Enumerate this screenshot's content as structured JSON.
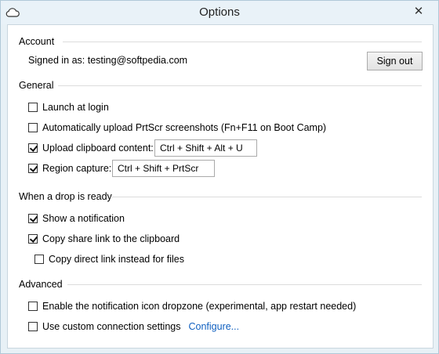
{
  "window": {
    "title": "Options",
    "close_glyph": "✕"
  },
  "account": {
    "heading": "Account",
    "signed_in_label": "Signed in as: testing@softpedia.com",
    "sign_out_label": "Sign out"
  },
  "general": {
    "heading": "General",
    "launch_at_login": {
      "label": "Launch at login",
      "checked": false
    },
    "auto_upload": {
      "label": "Automatically upload PrtScr screenshots (Fn+F11 on Boot Camp)",
      "checked": false
    },
    "upload_clipboard": {
      "label": "Upload clipboard content:",
      "checked": true,
      "hotkey": "Ctrl + Shift + Alt + U"
    },
    "region_capture": {
      "label": "Region capture:",
      "checked": true,
      "hotkey": "Ctrl + Shift + PrtScr"
    }
  },
  "drop": {
    "heading": "When a drop is ready",
    "show_notification": {
      "label": "Show a notification",
      "checked": true
    },
    "copy_share_link": {
      "label": "Copy share link to the clipboard",
      "checked": true
    },
    "copy_direct_link": {
      "label": "Copy direct link instead for files",
      "checked": false
    }
  },
  "advanced": {
    "heading": "Advanced",
    "notification_dropzone": {
      "label": "Enable the notification icon dropzone (experimental, app restart needed)",
      "checked": false
    },
    "custom_connection": {
      "label": "Use custom connection settings",
      "checked": false,
      "configure_link": "Configure..."
    }
  },
  "colors": {
    "accent_link": "#1060c0",
    "title_bar": "#e9f2f8"
  }
}
